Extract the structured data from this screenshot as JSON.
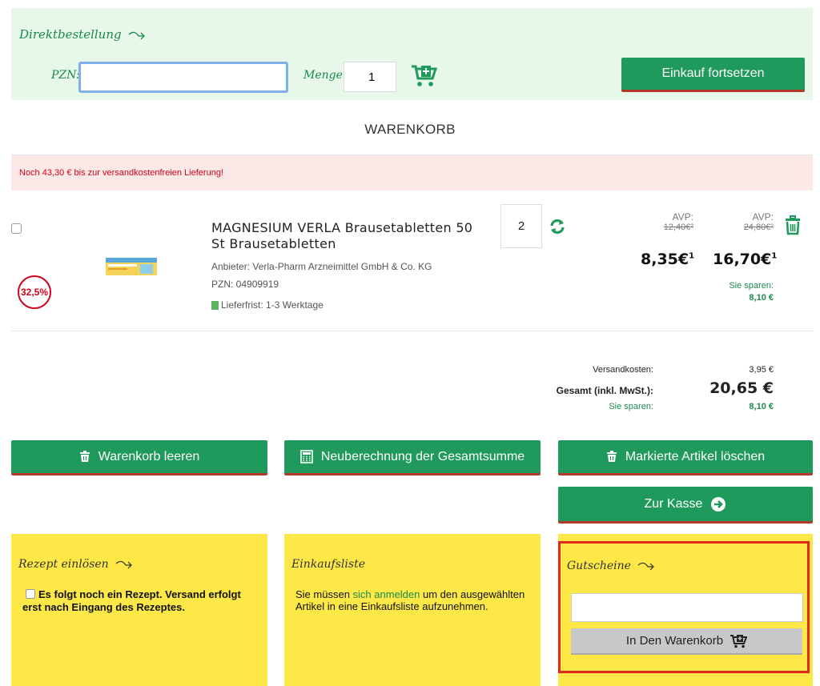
{
  "direct_order": {
    "title": "Direktbestellung",
    "pzn_label": "PZN:",
    "pzn_value": "",
    "menge_label": "Menge:",
    "menge_value": "1",
    "continue_label": "Einkauf fortsetzen"
  },
  "cart_title": "WARENKORB",
  "shipping_notice": "Noch 43,30 € bis zur versandkostenfreien Lieferung!",
  "product": {
    "name": "MAGNESIUM VERLA Brausetabletten 50 St Brausetabletten",
    "provider": "Anbieter: Verla-Pharm Arzneimittel GmbH & Co. KG",
    "pzn": "PZN: 04909919",
    "delivery": "Lieferfrist: 1-3 Werktage",
    "discount": "32,5%",
    "quantity": "2",
    "unit_avp_label": "AVP:",
    "unit_avp_old": "12,40€²",
    "unit_price": "8,35€",
    "unit_price_sup": "1",
    "total_avp_label": "AVP:",
    "total_avp_old": "24,80€²",
    "total_price": "16,70€",
    "total_price_sup": "1",
    "saving_label": "Sie sparen:",
    "saving_value": "8,10 €"
  },
  "totals": {
    "shipping_label": "Versandkosten:",
    "shipping_value": "3,95 €",
    "total_label": "Gesamt (inkl. MwSt.):",
    "total_value": "20,65 €",
    "saving_label": "Sie sparen:",
    "saving_value": "8,10 €"
  },
  "actions": {
    "clear_cart": "Warenkorb leeren",
    "recalculate": "Neuberechnung der Gesamtsumme",
    "delete_marked": "Markierte Artikel löschen",
    "checkout": "Zur Kasse"
  },
  "rezept": {
    "title": "Rezept einlösen",
    "text": "Es folgt noch ein Rezept. Versand erfolgt erst nach Eingang des Rezeptes."
  },
  "einkaufsliste": {
    "title": "Einkaufsliste",
    "text_before": "Sie müssen ",
    "link": "sich anmelden",
    "text_after": " um den ausgewählten Artikel in eine Einkaufsliste aufzunehmen."
  },
  "gutscheine": {
    "title": "Gutscheine",
    "input_value": "",
    "button_label": "In Den Warenkorb"
  },
  "colors": {
    "green": "#1f9a5c",
    "mint_bg": "#e7f7e9",
    "notice_bg": "#fde8e8",
    "notice_text": "#d0021b",
    "yellow": "#fde847",
    "highlight_border": "#e0291c"
  }
}
